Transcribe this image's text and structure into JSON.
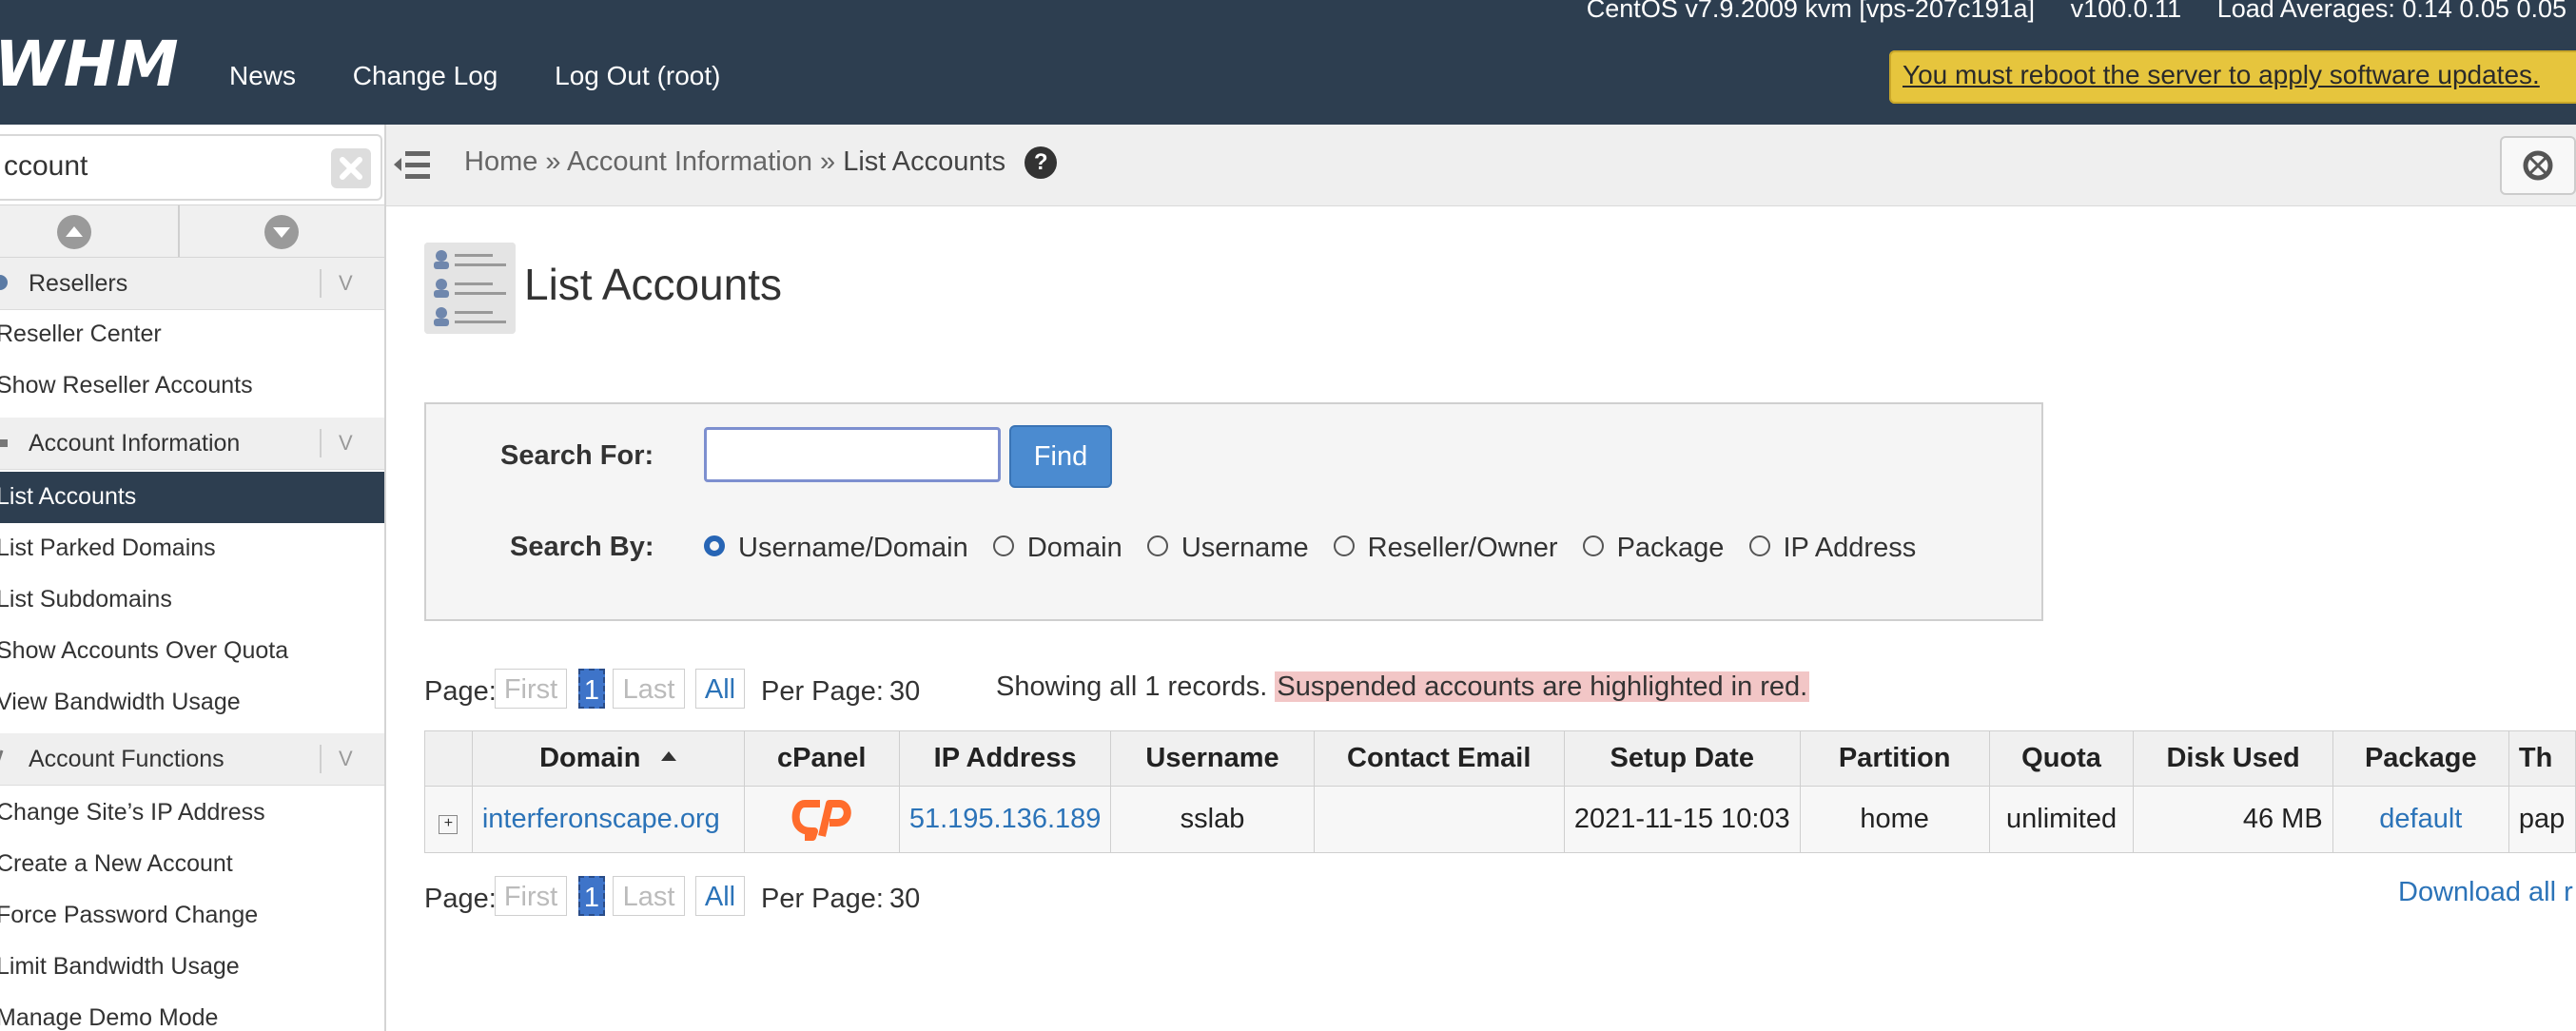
{
  "header": {
    "system_info": {
      "os": "CentOS v7.9.2009 kvm [vps-207c191a]",
      "version": "v100.0.11",
      "load": "Load Averages: 0.14 0.05 0.05"
    },
    "logo_text": "WHM",
    "nav": [
      "News",
      "Change Log",
      "Log Out (root)"
    ],
    "reboot_banner": "You must reboot the server to apply software updates."
  },
  "sidebar": {
    "search_value": "ccount",
    "sections": [
      {
        "label": "Resellers",
        "items": [
          "Reseller Center",
          "Show Reseller Accounts"
        ]
      },
      {
        "label": "Account Information",
        "items": [
          "List Accounts",
          "List Parked Domains",
          "List Subdomains",
          "Show Accounts Over Quota",
          "View Bandwidth Usage"
        ]
      },
      {
        "label": "Account Functions",
        "items": [
          "Change Site’s IP Address",
          "Create a New Account",
          "Force Password Change",
          "Limit Bandwidth Usage",
          "Manage Demo Mode"
        ]
      }
    ]
  },
  "breadcrumb": {
    "home": "Home",
    "sep": "»",
    "section": "Account Information",
    "current": "List Accounts",
    "help": "?"
  },
  "page": {
    "title": "List Accounts"
  },
  "search": {
    "for_label": "Search For:",
    "value": "",
    "find_label": "Find",
    "by_label": "Search By:",
    "options": [
      "Username/Domain",
      "Domain",
      "Username",
      "Reseller/Owner",
      "Package",
      "IP Address"
    ],
    "selected": "Username/Domain"
  },
  "pagination": {
    "page_label": "Page:",
    "first": "First",
    "current": "1",
    "last": "Last",
    "all": "All",
    "per_page_label": "Per Page:",
    "per_page_value": "30"
  },
  "records": {
    "text": "Showing all 1 records.",
    "suspended_note": "Suspended accounts are highlighted in red."
  },
  "table": {
    "columns": [
      "Domain",
      "cPanel",
      "IP Address",
      "Username",
      "Contact Email",
      "Setup Date",
      "Partition",
      "Quota",
      "Disk Used",
      "Package",
      "Th"
    ],
    "rows": [
      {
        "domain": "interferonscape.org",
        "ip": "51.195.136.189",
        "username": "sslab",
        "email": "",
        "setup_date": "2021-11-15 10:03",
        "partition": "home",
        "quota": "unlimited",
        "disk_used": "46 MB",
        "package": "default",
        "theme": "pap"
      }
    ]
  },
  "download_link": "Download all r",
  "colors": {
    "header_bg": "#2d3e50",
    "banner": "#e6c53d",
    "link": "#2b73b8",
    "primary_button": "#4b8bd0",
    "suspended_highlight": "#f2c6c6",
    "cpanel_orange": "#ff6c2c"
  }
}
